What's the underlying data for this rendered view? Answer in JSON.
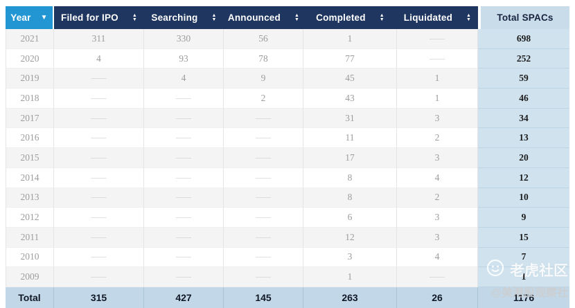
{
  "colors": {
    "year_header": "#2196d3",
    "header_navy": "#1f3660",
    "total_header": "#c9dcea",
    "total_cell": "#cfe2ee",
    "footer_row": "#c2d7e7"
  },
  "table": {
    "dash": "——",
    "columns": [
      {
        "key": "year",
        "label": "Year",
        "sort": "desc"
      },
      {
        "key": "filed",
        "label": "Filed for IPO",
        "sort": "both"
      },
      {
        "key": "searching",
        "label": "Searching",
        "sort": "both"
      },
      {
        "key": "announced",
        "label": "Announced",
        "sort": "both"
      },
      {
        "key": "completed",
        "label": "Completed",
        "sort": "both"
      },
      {
        "key": "liquidated",
        "label": "Liquidated",
        "sort": "both"
      },
      {
        "key": "total",
        "label": "Total SPACs",
        "sort": "none"
      }
    ],
    "rows": [
      {
        "year": "2021",
        "filed": "311",
        "searching": "330",
        "announced": "56",
        "completed": "1",
        "liquidated": "——",
        "total": "698"
      },
      {
        "year": "2020",
        "filed": "4",
        "searching": "93",
        "announced": "78",
        "completed": "77",
        "liquidated": "——",
        "total": "252"
      },
      {
        "year": "2019",
        "filed": "——",
        "searching": "4",
        "announced": "9",
        "completed": "45",
        "liquidated": "1",
        "total": "59"
      },
      {
        "year": "2018",
        "filed": "——",
        "searching": "——",
        "announced": "2",
        "completed": "43",
        "liquidated": "1",
        "total": "46"
      },
      {
        "year": "2017",
        "filed": "——",
        "searching": "——",
        "announced": "——",
        "completed": "31",
        "liquidated": "3",
        "total": "34"
      },
      {
        "year": "2016",
        "filed": "——",
        "searching": "——",
        "announced": "——",
        "completed": "11",
        "liquidated": "2",
        "total": "13"
      },
      {
        "year": "2015",
        "filed": "——",
        "searching": "——",
        "announced": "——",
        "completed": "17",
        "liquidated": "3",
        "total": "20"
      },
      {
        "year": "2014",
        "filed": "——",
        "searching": "——",
        "announced": "——",
        "completed": "8",
        "liquidated": "4",
        "total": "12"
      },
      {
        "year": "2013",
        "filed": "——",
        "searching": "——",
        "announced": "——",
        "completed": "8",
        "liquidated": "2",
        "total": "10"
      },
      {
        "year": "2012",
        "filed": "——",
        "searching": "——",
        "announced": "——",
        "completed": "6",
        "liquidated": "3",
        "total": "9"
      },
      {
        "year": "2011",
        "filed": "——",
        "searching": "——",
        "announced": "——",
        "completed": "12",
        "liquidated": "3",
        "total": "15"
      },
      {
        "year": "2010",
        "filed": "——",
        "searching": "——",
        "announced": "——",
        "completed": "3",
        "liquidated": "4",
        "total": "7"
      },
      {
        "year": "2009",
        "filed": "——",
        "searching": "——",
        "announced": "——",
        "completed": "1",
        "liquidated": "——",
        "total": "1"
      }
    ],
    "footer": {
      "label": "Total",
      "filed": "315",
      "searching": "427",
      "announced": "145",
      "completed": "263",
      "liquidated": "26",
      "total": "1176"
    }
  },
  "watermark": {
    "brand": "老虎社区",
    "handle": "@美港股观察社"
  }
}
